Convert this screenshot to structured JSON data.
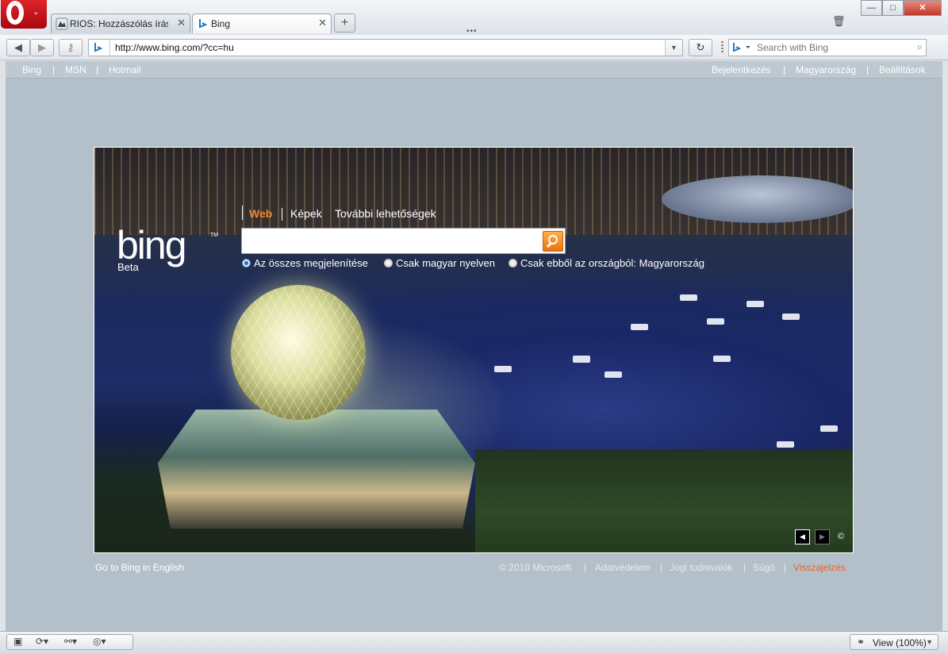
{
  "window": {
    "minimize_label": "—",
    "maximize_label": "□",
    "close_label": "✕"
  },
  "tabs": [
    {
      "label": "RIOS: Hozzászólás írás...",
      "close": "✕"
    },
    {
      "label": "Bing",
      "close": "✕"
    }
  ],
  "toolbar": {
    "address": "http://www.bing.com/?cc=hu",
    "search_placeholder": "Search with Bing"
  },
  "topnav": {
    "left": [
      "Bing",
      "MSN",
      "Hotmail"
    ],
    "right": [
      "Bejelentkezés",
      "Magyarország",
      "Beállítások"
    ],
    "separator": "|"
  },
  "hero": {
    "logo": "bing",
    "tm": "TM",
    "beta": "Beta",
    "search_tabs": [
      "Web",
      "Képek",
      "További lehetőségek"
    ],
    "radio_options": [
      "Az összes megjelenítése",
      "Csak magyar nyelven",
      "Csak ebből az országból: Magyarország"
    ],
    "selected_radio": 0,
    "prev_label": "◀",
    "next_label": "▶",
    "copyright": "©"
  },
  "footer": {
    "left": "Go to Bing in English",
    "links": [
      "© 2010 Microsoft",
      "Adatvédelem",
      "Jogi tudnivalók",
      "Súgó",
      "Visszajelzés"
    ],
    "feedback_color": "#e8602a"
  },
  "statusbar": {
    "view_label": "View (100%)"
  },
  "colors": {
    "accent": "#f0892b",
    "page_bg": "#b4c0c9",
    "opera_red": "#cc1419"
  }
}
